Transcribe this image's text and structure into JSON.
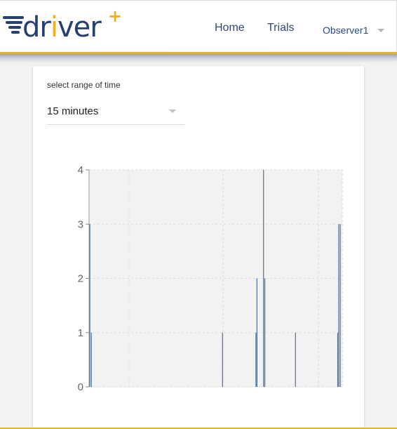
{
  "header": {
    "logo_text_pre": "dr",
    "logo_text_i": "i",
    "logo_text_post": "ver",
    "logo_plus": "+",
    "nav": [
      "Home",
      "Trials",
      "Observer1"
    ],
    "user_menu_icon": "chevron-down-icon"
  },
  "filter": {
    "label": "select range of time",
    "selected": "15 minutes"
  },
  "colors": {
    "brand_navy": "#243f72",
    "brand_gold": "#f0b01e",
    "bar_color": "#4a6f9a",
    "plot_bg": "#f2f2f2"
  },
  "chart_data": {
    "type": "bar",
    "ylim": [
      0,
      4
    ],
    "yticks": [
      "0",
      "1",
      "2",
      "3",
      "4"
    ],
    "grid": true,
    "x_range": [
      0,
      100
    ],
    "bars": [
      {
        "x": 0.3,
        "value": 3
      },
      {
        "x": 0.9,
        "value": 1
      },
      {
        "x": 52.7,
        "value": 1
      },
      {
        "x": 65.9,
        "value": 1
      },
      {
        "x": 66.3,
        "value": 2
      },
      {
        "x": 68.9,
        "value": 4
      },
      {
        "x": 69.4,
        "value": 2
      },
      {
        "x": 81.5,
        "value": 1
      },
      {
        "x": 98.2,
        "value": 1
      },
      {
        "x": 98.6,
        "value": 3
      },
      {
        "x": 99.2,
        "value": 3
      }
    ]
  }
}
